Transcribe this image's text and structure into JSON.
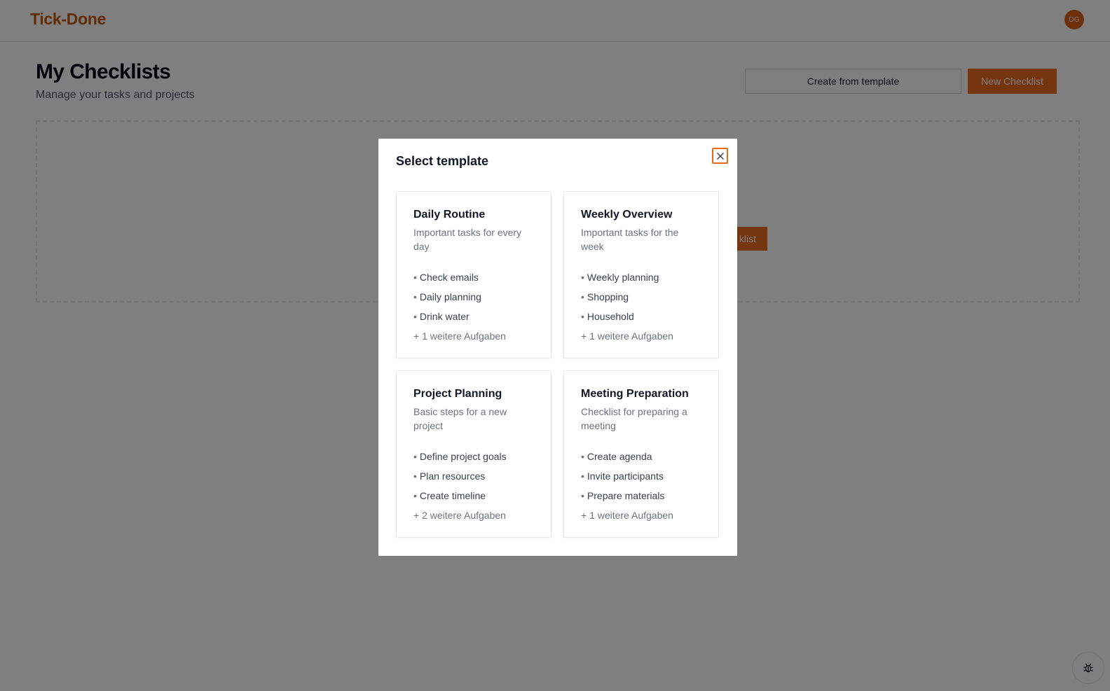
{
  "app": {
    "brand": "Tick-Done",
    "user_initials": "DG"
  },
  "header": {
    "title": "My Checklists",
    "subtitle": "Manage your tasks and projects",
    "create_from_template_label": "Create from template",
    "new_checklist_label": "New Checklist"
  },
  "empty_state": {
    "cta_label_partial": "klist"
  },
  "modal": {
    "title": "Select template",
    "templates": [
      {
        "title": "Daily Routine",
        "description": "Important tasks for every day",
        "tasks": [
          "Check emails",
          "Daily planning",
          "Drink water"
        ],
        "more": "+ 1 weitere Aufgaben"
      },
      {
        "title": "Weekly Overview",
        "description": "Important tasks for the week",
        "tasks": [
          "Weekly planning",
          "Shopping",
          "Household"
        ],
        "more": "+ 1 weitere Aufgaben"
      },
      {
        "title": "Project Planning",
        "description": "Basic steps for a new project",
        "tasks": [
          "Define project goals",
          "Plan resources",
          "Create timeline"
        ],
        "more": "+ 2 weitere Aufgaben"
      },
      {
        "title": "Meeting Preparation",
        "description": "Checklist for preparing a meeting",
        "tasks": [
          "Create agenda",
          "Invite participants",
          "Prepare materials"
        ],
        "more": "+ 1 weitere Aufgaben"
      }
    ]
  },
  "bullet": "•",
  "colors": {
    "accent": "#ea6a1c",
    "brand": "#c2570c",
    "overlay": "rgba(0,0,0,0.5)"
  },
  "icons": {
    "close": "close-icon",
    "bug": "bug-icon"
  }
}
